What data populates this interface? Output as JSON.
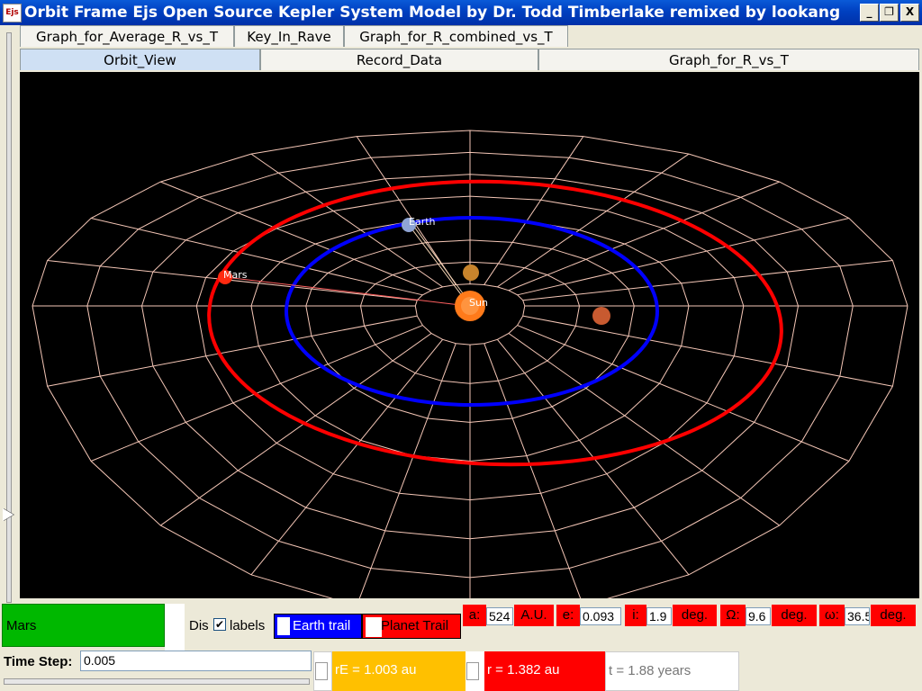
{
  "window": {
    "title": "Orbit Frame Ejs Open Source Kepler System Model by Dr. Todd Timberlake remixed by lookang",
    "logo": "Ejs",
    "minimize": "_",
    "restore": "❐",
    "close": "X"
  },
  "tabs_row1": [
    "Graph_for_Average_R_vs_T",
    "Key_In_Rave",
    "Graph_for_R_combined_vs_T"
  ],
  "tabs_row2": [
    "Orbit_View",
    "Record_Data",
    "Graph_for_R_vs_T"
  ],
  "scene": {
    "labels": {
      "earth": "Earth",
      "mars": "Mars",
      "sun": "Sun"
    },
    "colors": {
      "background": "#000000",
      "grid": "#f4c6b6",
      "earth_orbit": "#0000ff",
      "mars_orbit": "#ff0000",
      "sun": "#ff7a1a"
    }
  },
  "controls": {
    "planet_select": "Mars",
    "display_label": "Dis",
    "labels_checkbox": "labels",
    "labels_checked": true,
    "earth_trail": "Earth trail",
    "planet_trail": "Planet Trail",
    "a_label": "a:",
    "a_value": "524",
    "a_unit": "A.U.",
    "e_label": "e:",
    "e_value": "0.093",
    "i_label": "i:",
    "i_value": "1.9",
    "i_unit": "deg.",
    "omega_big_label": "Ω:",
    "omega_big_value": "9.6",
    "omega_big_unit": "deg.",
    "omega_small_label": "ω:",
    "omega_small_value": "36.5",
    "omega_small_unit": "deg.",
    "time_step_label": "Time Step:",
    "time_step_value": "0.005",
    "rE": "rE = 1.003 au",
    "r": "r = 1.382 au",
    "t": "t = 1.88 years"
  }
}
